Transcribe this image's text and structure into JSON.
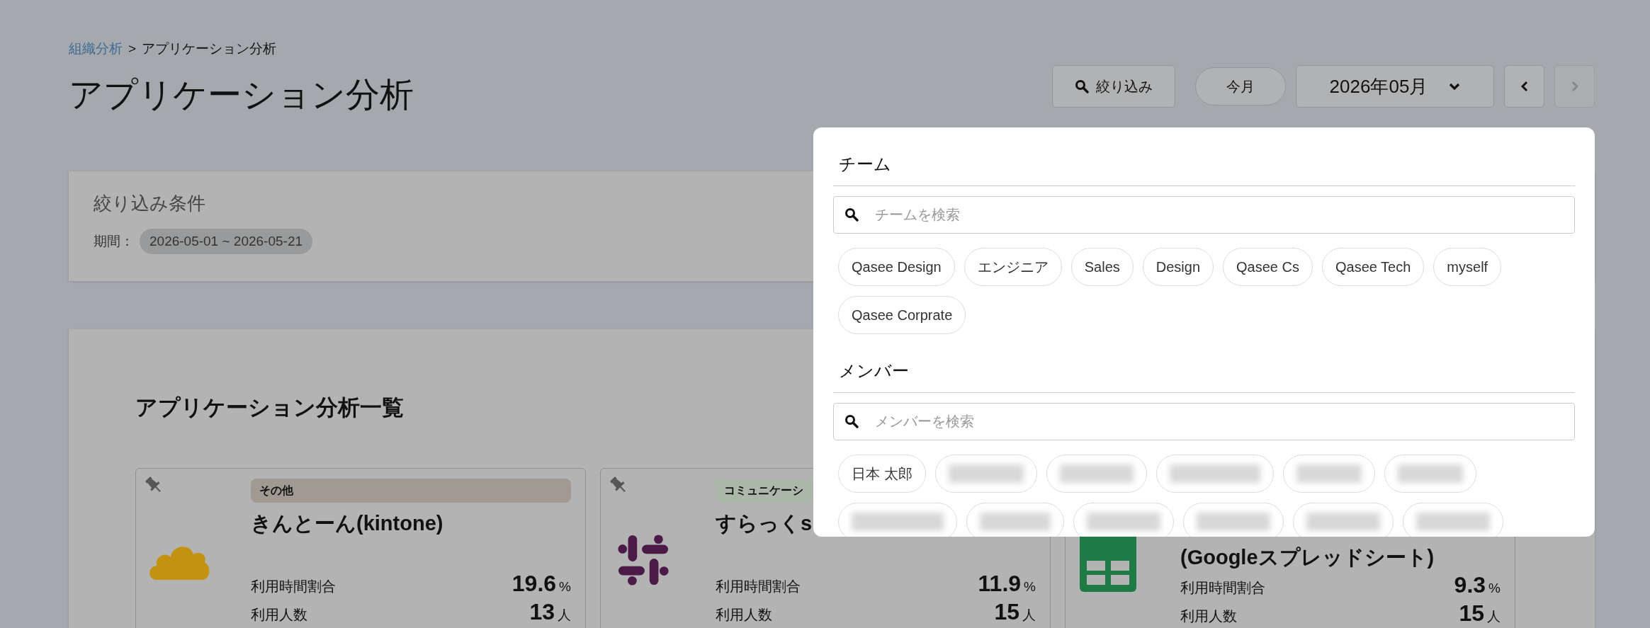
{
  "breadcrumb": [
    {
      "label": "組織分析",
      "link": true
    },
    {
      "label": "アプリケーション分析",
      "link": false
    }
  ],
  "breadcrumb_separator": ">",
  "title": "アプリケーション分析",
  "toolbar": {
    "filter_button": "絞り込み",
    "this_month_button": "今月",
    "month_select": "2026年05月",
    "prev_disabled": false,
    "next_disabled": true
  },
  "filter_conditions": {
    "title": "絞り込み条件",
    "period_label": "期間：",
    "period_value": "2026-05-01 ~ 2026-05-21"
  },
  "app_list": {
    "title": "アプリケーション分析一覧",
    "apps": [
      {
        "category": "その他",
        "color": "#a09a93",
        "name": "きんとーん(kintone)",
        "kind": "cloud",
        "time_share_label": "利用時間割合",
        "time_share": "19.6",
        "time_share_unit": "%",
        "users_label": "利用人数",
        "users": "13",
        "users_unit": "人"
      },
      {
        "category": "コミュニケーシ",
        "color": "#abb8a9",
        "name": "すらっくs",
        "kind": "hash",
        "time_share_label": "利用時間割合",
        "time_share": "11.9",
        "time_share_unit": "%",
        "users_label": "利用人数",
        "users": "15",
        "users_unit": "人"
      },
      {
        "name": "(Googleスプレッドシート)",
        "kind": "sheet",
        "time_share_label": "利用時間割合",
        "time_share": "9.3",
        "time_share_unit": "%",
        "users_label": "利用人数",
        "users": "15",
        "users_unit": "人"
      }
    ]
  },
  "filter_popover": {
    "sections": [
      {
        "title": "チーム",
        "placeholder": "チームを検索",
        "chips": [
          {
            "kind": "name",
            "label": "Qasee Design"
          },
          {
            "kind": "name",
            "label": "エンジニア"
          },
          {
            "kind": "name",
            "label": "Sales"
          },
          {
            "kind": "name",
            "label": "Design"
          },
          {
            "kind": "name",
            "label": "Qasee Cs"
          },
          {
            "kind": "name",
            "label": "Qasee Tech"
          },
          {
            "kind": "name",
            "label": "myself"
          },
          {
            "kind": "name",
            "label": "Qasee Corprate"
          }
        ]
      },
      {
        "title": "メンバー",
        "placeholder": "メンバーを検索",
        "chips": [
          {
            "kind": "name",
            "label": "日本 太郎"
          },
          {
            "kind": "blurred"
          },
          {
            "kind": "blurred"
          },
          {
            "kind": "blurred"
          },
          {
            "kind": "blurred"
          },
          {
            "kind": "blurred"
          },
          {
            "kind": "blurred"
          },
          {
            "kind": "blurred"
          },
          {
            "kind": "blurred"
          },
          {
            "kind": "blurred"
          },
          {
            "kind": "blurred"
          },
          {
            "kind": "blurred"
          }
        ]
      }
    ]
  }
}
